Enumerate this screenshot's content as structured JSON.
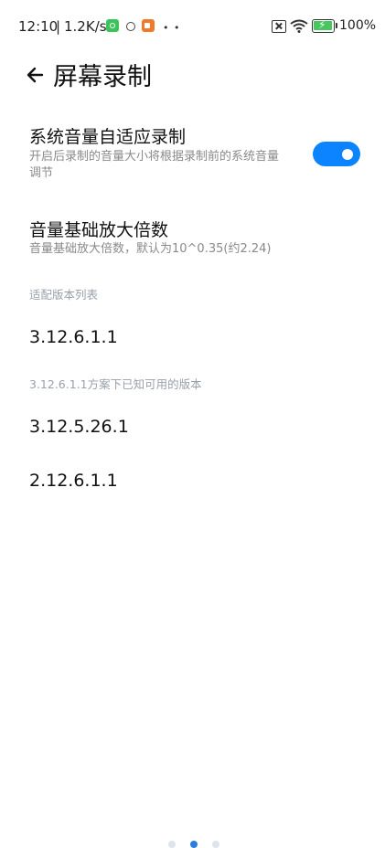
{
  "status_bar": {
    "time": "12:10",
    "separator": "|",
    "net_speed": "1.2K/s",
    "battery_percent": "100%",
    "icons": [
      "green-app-icon",
      "circle-icon",
      "orange-video-icon",
      "more-dots-icon",
      "sim-disabled-icon",
      "wifi-icon",
      "battery-charging-icon"
    ],
    "dots": "• •"
  },
  "header": {
    "title": "屏幕录制",
    "back_icon": "arrow-left-icon"
  },
  "settings": {
    "adaptive": {
      "title": "系统音量自适应录制",
      "desc_line1": "开启后录制的音量大小将根据录制前的系统音量",
      "desc_line2": "调节",
      "enabled": true,
      "accent_color": "#0d84ff"
    },
    "amplify": {
      "title": "音量基础放大倍数",
      "desc": "音量基础放大倍数，默认为10^0.35(约2.24)"
    }
  },
  "versions_section": {
    "label": "适配版本列表",
    "items": [
      "3.12.6.1.1",
      "3.12.5.26.1",
      "2.12.6.1.1"
    ],
    "note": "3.12.6.1.1方案下已知可用的版本"
  }
}
